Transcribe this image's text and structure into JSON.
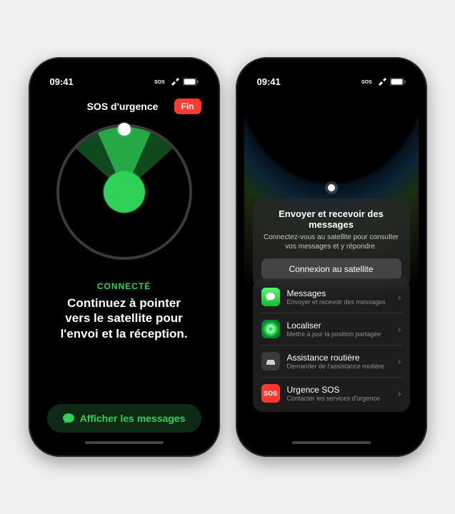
{
  "status": {
    "time": "09:41"
  },
  "phone1": {
    "title": "SOS d'urgence",
    "end_button": "Fin",
    "connected_label": "CONNECTÉ",
    "instruction": "Continuez à pointer vers le satellite pour l'envoi et la réception.",
    "show_messages": "Afficher les messages"
  },
  "phone2": {
    "card_title": "Envoyer et recevoir des messages",
    "card_subtitle": "Connectez-vous au satellite pour consulter vos messages et y répondre.",
    "connect_button": "Connexion au satellite",
    "items": [
      {
        "title": "Messages",
        "subtitle": "Envoyer et recevoir des messages"
      },
      {
        "title": "Localiser",
        "subtitle": "Mettre à jour la position partagée"
      },
      {
        "title": "Assistance routière",
        "subtitle": "Demander de l'assistance routière"
      },
      {
        "title": "Urgence SOS",
        "subtitle": "Contacter les services d'urgence"
      }
    ],
    "sos_abbrev": "SOS"
  }
}
